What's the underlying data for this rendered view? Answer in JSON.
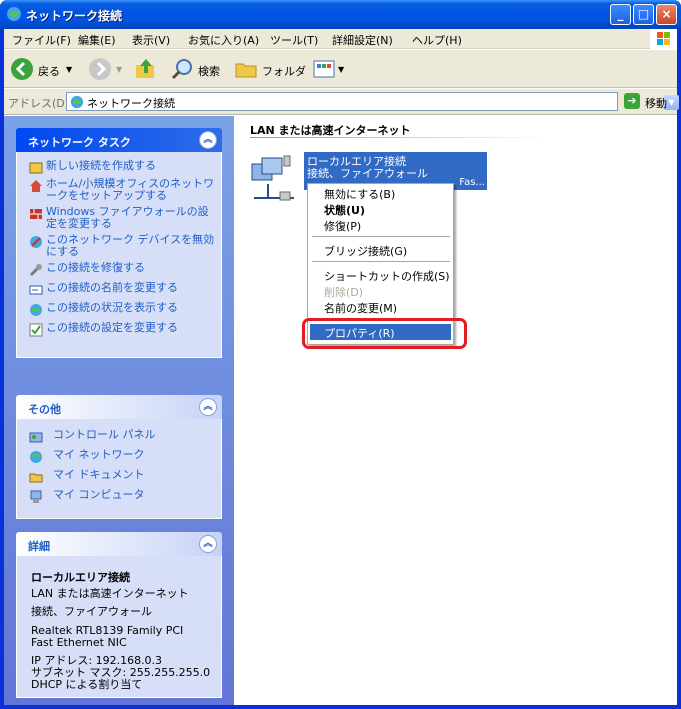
{
  "window": {
    "title": "ネットワーク接続",
    "min_label": "_",
    "max_label": "□",
    "close_label": "×"
  },
  "menu": [
    "ファイル(F)",
    "編集(E)",
    "表示(V)",
    "お気に入り(A)",
    "ツール(T)",
    "詳細設定(N)",
    "ヘルプ(H)"
  ],
  "toolbar": {
    "back": "戻る",
    "search": "検索",
    "folders": "フォルダ"
  },
  "address": {
    "label": "アドレス(D)",
    "value": "ネットワーク接続",
    "go": "移動"
  },
  "network_tasks": {
    "title": "ネットワーク タスク",
    "items": [
      "新しい接続を作成する",
      "ホーム/小規模オフィスのネットワークをセットアップする",
      "Windows ファイアウォールの設定を変更する",
      "このネットワーク デバイスを無効にする",
      "この接続を修復する",
      "この接続の名前を変更する",
      "この接続の状況を表示する",
      "この接続の設定を変更する"
    ]
  },
  "other_places": {
    "title": "その他",
    "items": [
      "コントロール パネル",
      "マイ ネットワーク",
      "マイ ドキュメント",
      "マイ コンピュータ"
    ]
  },
  "details": {
    "title": "詳細",
    "name": "ローカルエリア接続",
    "type_line1": "LAN または高速インターネット",
    "type_line2": "接続、ファイアウォール",
    "adapter_line1": "Realtek RTL8139 Family PCI",
    "adapter_line2": "Fast Ethernet NIC",
    "ip": "IP アドレス: 192.168.0.3",
    "subnet": "サブネット マスク: 255.255.255.0",
    "dhcp": "DHCP による割り当て"
  },
  "content": {
    "group_header": "LAN または高速インターネット",
    "connection_line1": "ローカルエリア接続",
    "connection_line2": "接続、ファイアウォール",
    "connection_line3": "Fas..."
  },
  "context_menu": {
    "disable": "無効にする(B)",
    "status": "状態(U)",
    "repair": "修復(P)",
    "bridge": "ブリッジ接続(G)",
    "shortcut": "ショートカットの作成(S)",
    "delete": "削除(D)",
    "rename": "名前の変更(M)",
    "properties": "プロパティ(R)"
  },
  "colors": {
    "highlight": "#316ac5",
    "annotation": "#e31b23",
    "task_link": "#215dc6"
  }
}
